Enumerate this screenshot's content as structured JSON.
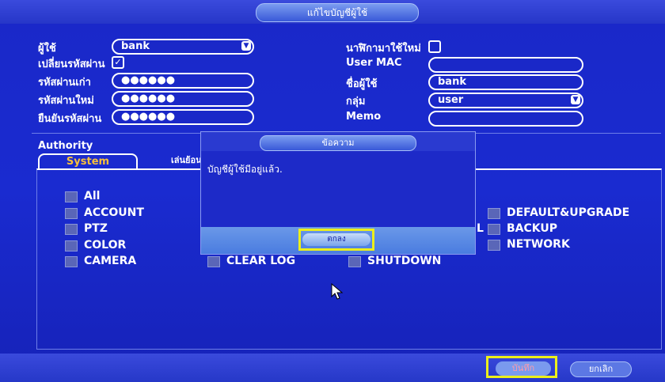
{
  "window": {
    "title": "แก้ไขบัญชีผู้ใช้"
  },
  "form": {
    "user_label": "ผู้ใช้",
    "user_value": "bank",
    "change_password_label": "เปลี่ยนรหัสผ่าน",
    "old_password_label": "รหัสผ่านเก่า",
    "old_password_value": "●●●●●●",
    "new_password_label": "รหัสผ่านใหม่",
    "new_password_value": "●●●●●●",
    "confirm_password_label": "ยืนยันรหัสผ่าน",
    "confirm_password_value": "●●●●●●",
    "reuse_label": "นาฬิกามาใช้ใหม่",
    "user_mac_label": "User MAC",
    "user_mac_value": "",
    "username_label": "ชื่อผู้ใช้",
    "username_value": "bank",
    "group_label": "กลุ่ม",
    "group_value": "user",
    "memo_label": "Memo",
    "memo_value": ""
  },
  "authority": {
    "heading": "Authority",
    "tabs": [
      "System",
      "เล่นย้อน"
    ],
    "permissions_col1": [
      "All",
      "ACCOUNT",
      "PTZ",
      "COLOR",
      "CAMERA"
    ],
    "permissions_col2": [
      "CLEAR LOG"
    ],
    "permissions_col3": [
      "SHUTDOWN"
    ],
    "permissions_col4": [
      "DEFAULT&UPGRADE",
      "BACKUP",
      "NETWORK"
    ],
    "partial_label": "L"
  },
  "dialog": {
    "title": "ข้อความ",
    "message": "บัญชีผู้ใช้มีอยู่แล้ว.",
    "ok_label": "ตกลง"
  },
  "footer": {
    "save_label": "บันทึก",
    "cancel_label": "ยกเลิก"
  },
  "colors": {
    "highlight": "#ecef1a",
    "background": "#1a28c8",
    "active_tab": "#f8c03a"
  }
}
